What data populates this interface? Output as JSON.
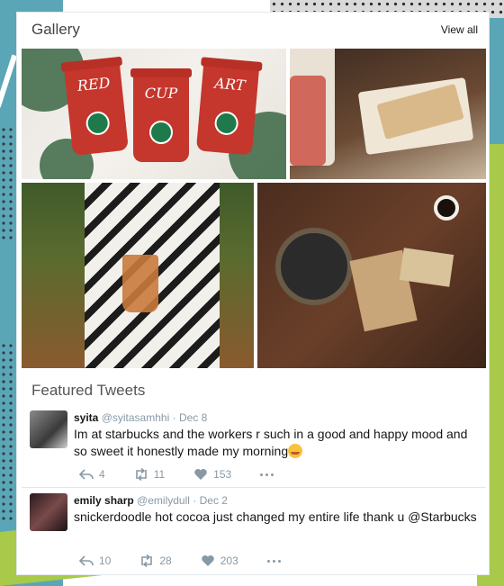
{
  "gallery": {
    "title": "Gallery",
    "view_all": "View all",
    "photos": [
      {
        "name": "red-cups-photo",
        "cups": [
          "RED",
          "CUP",
          "ART"
        ]
      },
      {
        "name": "cake-slice-photo"
      },
      {
        "name": "patterned-sweater-drink-photo"
      },
      {
        "name": "table-autumn-photo"
      }
    ]
  },
  "featured": {
    "title": "Featured Tweets",
    "tweets": [
      {
        "name": "syita",
        "handle": "@syitasamhhi",
        "dot": "·",
        "date": "Dec 8",
        "text": "Im at starbucks and the workers r such in a good and happy mood and so sweet it honestly made my morning",
        "emoji": "smiling-blush-emoji",
        "replies": "4",
        "retweets": "11",
        "likes": "153"
      },
      {
        "name": "emily sharp",
        "handle": "@emilydull",
        "dot": "·",
        "date": "Dec 2",
        "text": "snickerdoodle hot cocoa just changed my entire life thank u @Starbucks",
        "replies": "10",
        "retweets": "28",
        "likes": "203"
      }
    ]
  }
}
